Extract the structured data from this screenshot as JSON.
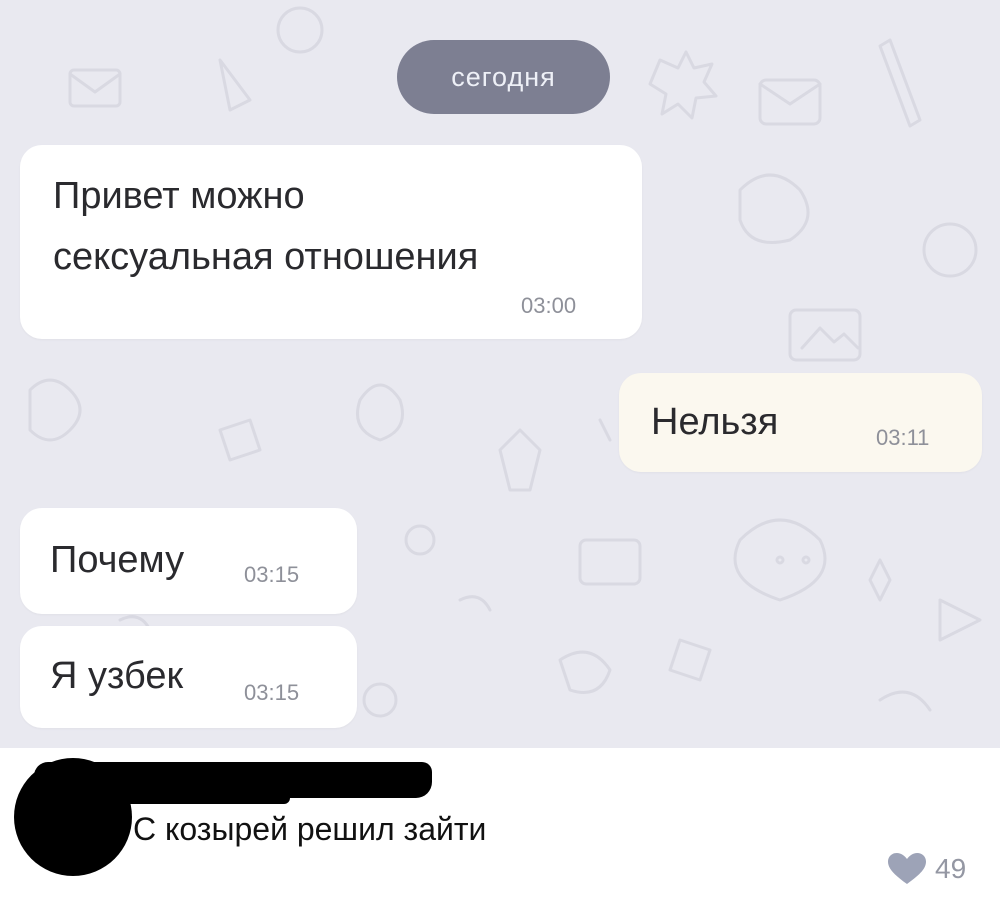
{
  "chat": {
    "date_separator": "сегодня",
    "messages": [
      {
        "direction": "incoming",
        "lines": [
          "Привет можно",
          "сексуальная отношения"
        ],
        "time": "03:00"
      },
      {
        "direction": "outgoing",
        "lines": [
          "Нельзя"
        ],
        "time": "03:11"
      },
      {
        "direction": "incoming",
        "lines": [
          "Почему"
        ],
        "time": "03:15"
      },
      {
        "direction": "incoming",
        "lines": [
          "Я узбек"
        ],
        "time": "03:15"
      }
    ]
  },
  "comment": {
    "text": "С козырей решил зайти",
    "likes": "49",
    "like_icon": "heart-icon"
  },
  "colors": {
    "chat_background": "#e9e9f0",
    "date_pill": "#7d7f92",
    "incoming_bubble": "#ffffff",
    "outgoing_bubble": "#fbf8ef",
    "like_heart": "#9da3b7"
  }
}
